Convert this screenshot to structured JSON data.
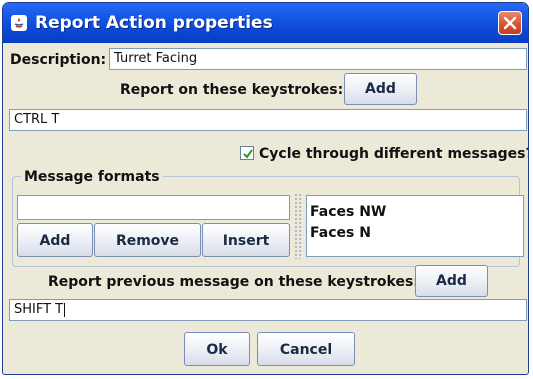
{
  "window": {
    "title": "Report Action properties"
  },
  "form": {
    "description_label": "Description:",
    "description_value": "Turret Facing",
    "report_keystrokes_label": "Report on these keystrokes:",
    "report_keystrokes_add": "Add",
    "report_keystrokes_value": "CTRL T",
    "cycle_label": "Cycle through different messages?",
    "cycle_checked": true,
    "message_formats": {
      "title": "Message formats",
      "input_value": "",
      "buttons": {
        "add": "Add",
        "remove": "Remove",
        "insert": "Insert"
      },
      "items": [
        "Faces NW",
        "Faces N"
      ]
    },
    "report_previous_label": "Report previous message on these keystrokes:",
    "report_previous_add": "Add",
    "report_previous_value": "SHIFT T"
  },
  "footer": {
    "ok": "Ok",
    "cancel": "Cancel"
  },
  "colors": {
    "titlebar": "#0b45d0",
    "close_button": "#d6512e",
    "dialog_bg": "#ece9d8",
    "field_border": "#7f9db9"
  }
}
